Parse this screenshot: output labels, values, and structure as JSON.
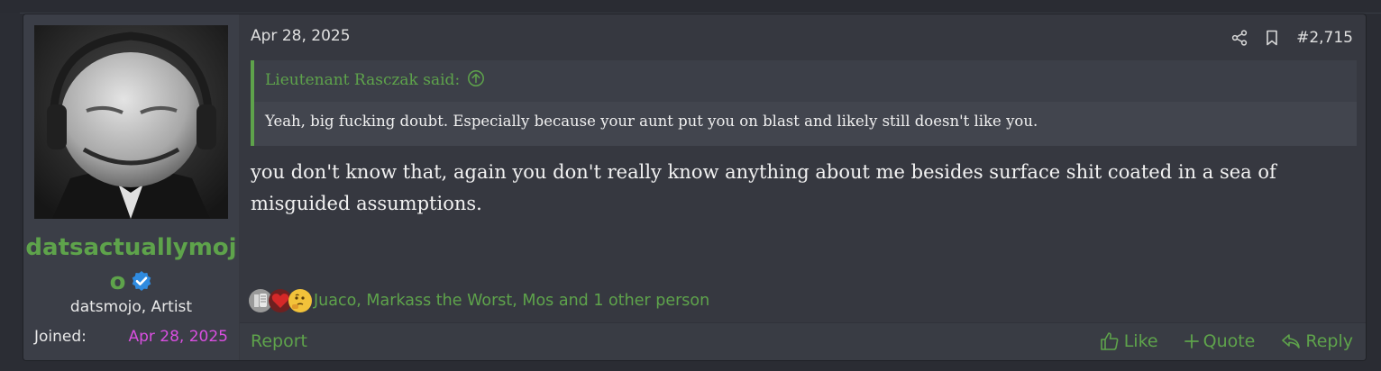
{
  "post": {
    "date": "Apr 28, 2025",
    "post_number": "#2,715",
    "author": {
      "username": "datsactuallymojo",
      "title": "datsmojo, Artist",
      "joined_label": "Joined:",
      "joined_value": "Apr 28, 2025"
    },
    "quote": {
      "header": "Lieutenant Rasczak said:",
      "text": "Yeah, big fucking doubt. Especially because your aunt put you on blast and likely still doesn't like you."
    },
    "message": "you don't know that, again you don't really know anything about me besides surface shit coated in a sea of misguided assumptions.",
    "reactions": {
      "icons": [
        "dislike-icon",
        "heart-icon",
        "thinking-icon"
      ],
      "list": "Juaco, Markass the Worst, Mos and 1 other person"
    },
    "footer": {
      "report_label": "Report",
      "like_label": "Like",
      "quote_label": "Quote",
      "reply_label": "Reply"
    }
  },
  "colors": {
    "accent": "#5ea34b",
    "joined_date": "#d94fe0",
    "background": "#363840"
  }
}
